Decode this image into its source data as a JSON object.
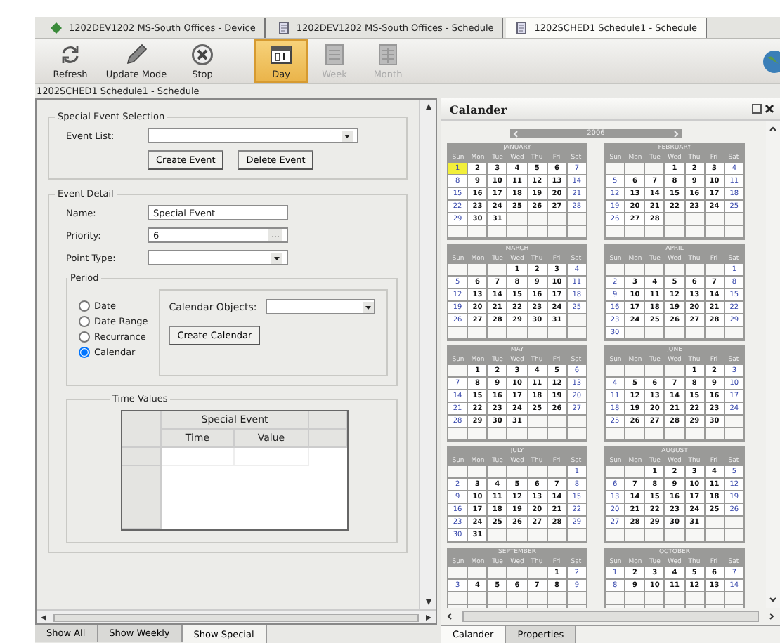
{
  "document_tabs": [
    {
      "label": "1202DEV1202 MS-South Offices - Device",
      "kind": "device",
      "selected": false
    },
    {
      "label": "1202DEV1202 MS-South Offices - Schedule",
      "kind": "schedule",
      "selected": false
    },
    {
      "label": "1202SCHED1 Schedule1 - Schedule",
      "kind": "schedule",
      "selected": true
    }
  ],
  "toolbar": [
    {
      "label": "Refresh",
      "kind": "refresh",
      "selected": false,
      "disabled": false
    },
    {
      "label": "Update Mode",
      "kind": "pencil",
      "selected": false,
      "disabled": false
    },
    {
      "label": "Stop",
      "kind": "stop",
      "selected": false,
      "disabled": false
    },
    {
      "label": "Day",
      "kind": "day",
      "selected": true,
      "disabled": false
    },
    {
      "label": "Week",
      "kind": "week",
      "selected": false,
      "disabled": true
    },
    {
      "label": "Month",
      "kind": "month",
      "selected": false,
      "disabled": true
    }
  ],
  "breadcrumb": "1202SCHED1 Schedule1 - Schedule",
  "special_event_selection": {
    "title": "Special Event Selection",
    "event_list_label": "Event List:",
    "buttons": [
      "Create Event",
      "Delete Event"
    ]
  },
  "event_detail": {
    "title": "Event Detail",
    "fields": [
      {
        "label": "Name:",
        "kind": "text",
        "value": "Special Event"
      },
      {
        "label": "Priority:",
        "kind": "ellipsis",
        "value": "6",
        "button": "..."
      },
      {
        "label": "Point Type:",
        "kind": "dropdown"
      }
    ]
  },
  "period": {
    "title": "Period",
    "options": [
      {
        "label": "Date",
        "selected": false
      },
      {
        "label": "Date Range",
        "selected": false
      },
      {
        "label": "Recurrance",
        "selected": false
      },
      {
        "label": "Calendar",
        "selected": true
      }
    ],
    "calendar_objects_label": "Calendar Objects:",
    "create_button": "Create Calendar"
  },
  "time_values": {
    "title": "Time Values",
    "group_header": "Special Event",
    "columns": [
      "Time",
      "Value"
    ]
  },
  "bottom_tabs": [
    {
      "label": "Show All",
      "selected": false
    },
    {
      "label": "Show Weekly",
      "selected": false
    },
    {
      "label": "Show Special",
      "selected": true
    }
  ],
  "calendar_panel": {
    "title": "Calander",
    "year": "2006",
    "months": [
      {
        "name": "JANUARY",
        "weekdays": [
          "Sun",
          "Mon",
          "Tue",
          "Wed",
          "Thu",
          "Fri",
          "Sat"
        ],
        "weeks": [
          [
            {
              "kind": "day",
              "text": "1",
              "selected": true
            },
            "2",
            "3",
            "4",
            "5",
            "6",
            "7"
          ],
          [
            "8",
            "9",
            "10",
            "11",
            "12",
            "13",
            "14"
          ],
          [
            "15",
            "16",
            "17",
            "18",
            "19",
            "20",
            "21"
          ],
          [
            "22",
            "23",
            "24",
            "25",
            "26",
            "27",
            "28"
          ],
          [
            "29",
            "30",
            "31",
            {
              "kind": "blank"
            },
            {
              "kind": "blank"
            },
            {
              "kind": "blank"
            },
            {
              "kind": "blank"
            }
          ]
        ]
      },
      {
        "name": "FEBRUARY",
        "weekdays": [
          "Sun",
          "Mon",
          "Tue",
          "Wed",
          "Thu",
          "Fri",
          "Sat"
        ],
        "weeks": [
          [
            {
              "kind": "blank"
            },
            {
              "kind": "blank"
            },
            {
              "kind": "blank"
            },
            "1",
            "2",
            "3",
            "4"
          ],
          [
            "5",
            "6",
            "7",
            "8",
            "9",
            "10",
            "11"
          ],
          [
            "12",
            "13",
            "14",
            "15",
            "16",
            "17",
            "18"
          ],
          [
            "19",
            "20",
            "21",
            "22",
            "23",
            "24",
            "25"
          ],
          [
            "26",
            "27",
            "28",
            {
              "kind": "blank"
            },
            {
              "kind": "blank"
            },
            {
              "kind": "blank"
            },
            {
              "kind": "blank"
            }
          ]
        ]
      },
      {
        "name": "MARCH",
        "weekdays": [
          "Sun",
          "Mon",
          "Tue",
          "Wed",
          "Thu",
          "Fri",
          "Sat"
        ],
        "weeks": [
          [
            {
              "kind": "blank"
            },
            {
              "kind": "blank"
            },
            {
              "kind": "blank"
            },
            "1",
            "2",
            "3",
            "4"
          ],
          [
            "5",
            "6",
            "7",
            "8",
            "9",
            "10",
            "11"
          ],
          [
            "12",
            "13",
            "14",
            "15",
            "16",
            "17",
            "18"
          ],
          [
            "19",
            "20",
            "21",
            "22",
            "23",
            "24",
            "25"
          ],
          [
            "26",
            "27",
            "28",
            "29",
            "30",
            "31",
            {
              "kind": "blank"
            }
          ]
        ]
      },
      {
        "name": "APRIL",
        "weekdays": [
          "Sun",
          "Mon",
          "Tue",
          "Wed",
          "Thu",
          "Fri",
          "Sat"
        ],
        "weeks": [
          [
            {
              "kind": "blank"
            },
            {
              "kind": "blank"
            },
            {
              "kind": "blank"
            },
            {
              "kind": "blank"
            },
            {
              "kind": "blank"
            },
            {
              "kind": "blank"
            },
            "1"
          ],
          [
            "2",
            "3",
            "4",
            "5",
            "6",
            "7",
            "8"
          ],
          [
            "9",
            "10",
            "11",
            "12",
            "13",
            "14",
            "15"
          ],
          [
            "16",
            "17",
            "18",
            "19",
            "20",
            "21",
            "22"
          ],
          [
            "23",
            "24",
            "25",
            "26",
            "27",
            "28",
            "29"
          ],
          [
            "30",
            {
              "kind": "blank"
            },
            {
              "kind": "blank"
            },
            {
              "kind": "blank"
            },
            {
              "kind": "blank"
            },
            {
              "kind": "blank"
            },
            {
              "kind": "blank"
            }
          ]
        ]
      },
      {
        "name": "MAY",
        "weekdays": [
          "Sun",
          "Mon",
          "Tue",
          "Wed",
          "Thu",
          "Fri",
          "Sat"
        ],
        "weeks": [
          [
            {
              "kind": "blank"
            },
            "1",
            "2",
            "3",
            "4",
            "5",
            "6"
          ],
          [
            "7",
            "8",
            "9",
            "10",
            "11",
            "12",
            "13"
          ],
          [
            "14",
            "15",
            "16",
            "17",
            "18",
            "19",
            "20"
          ],
          [
            "21",
            "22",
            "23",
            "24",
            "25",
            "26",
            "27"
          ],
          [
            "28",
            "29",
            "30",
            "31",
            {
              "kind": "blank"
            },
            {
              "kind": "blank"
            },
            {
              "kind": "blank"
            }
          ]
        ]
      },
      {
        "name": "JUNE",
        "weekdays": [
          "Sun",
          "Mon",
          "Tue",
          "Wed",
          "Thu",
          "Fri",
          "Sat"
        ],
        "weeks": [
          [
            {
              "kind": "blank"
            },
            {
              "kind": "blank"
            },
            {
              "kind": "blank"
            },
            {
              "kind": "blank"
            },
            "1",
            "2",
            "3"
          ],
          [
            "4",
            "5",
            "6",
            "7",
            "8",
            "9",
            "10"
          ],
          [
            "11",
            "12",
            "13",
            "14",
            "15",
            "16",
            "17"
          ],
          [
            "18",
            "19",
            "20",
            "21",
            "22",
            "23",
            "24"
          ],
          [
            "25",
            "26",
            "27",
            "28",
            "29",
            "30",
            {
              "kind": "blank"
            }
          ]
        ]
      },
      {
        "name": "JULY",
        "weekdays": [
          "Sun",
          "Mon",
          "Tue",
          "Wed",
          "Thu",
          "Fri",
          "Sat"
        ],
        "weeks": [
          [
            {
              "kind": "blank"
            },
            {
              "kind": "blank"
            },
            {
              "kind": "blank"
            },
            {
              "kind": "blank"
            },
            {
              "kind": "blank"
            },
            {
              "kind": "blank"
            },
            "1"
          ],
          [
            "2",
            "3",
            "4",
            "5",
            "6",
            "7",
            "8"
          ],
          [
            "9",
            "10",
            "11",
            "12",
            "13",
            "14",
            "15"
          ],
          [
            "16",
            "17",
            "18",
            "19",
            "20",
            "21",
            "22"
          ],
          [
            "23",
            "24",
            "25",
            "26",
            "27",
            "28",
            "29"
          ],
          [
            "30",
            "31",
            {
              "kind": "blank"
            },
            {
              "kind": "blank"
            },
            {
              "kind": "blank"
            },
            {
              "kind": "blank"
            },
            {
              "kind": "blank"
            }
          ]
        ]
      },
      {
        "name": "AUGUST",
        "weekdays": [
          "Sun",
          "Mon",
          "Tue",
          "Wed",
          "Thu",
          "Fri",
          "Sat"
        ],
        "weeks": [
          [
            {
              "kind": "blank"
            },
            {
              "kind": "blank"
            },
            "1",
            "2",
            "3",
            "4",
            "5"
          ],
          [
            "6",
            "7",
            "8",
            "9",
            "10",
            "11",
            "12"
          ],
          [
            "13",
            "14",
            "15",
            "16",
            "17",
            "18",
            "19"
          ],
          [
            "20",
            "21",
            "22",
            "23",
            "24",
            "25",
            "26"
          ],
          [
            "27",
            "28",
            "29",
            "30",
            "31",
            {
              "kind": "blank"
            },
            {
              "kind": "blank"
            }
          ]
        ]
      },
      {
        "name": "SEPTEMBER",
        "weekdays": [
          "Sun",
          "Mon",
          "Tue",
          "Wed",
          "Thu",
          "Fri",
          "Sat"
        ],
        "weeks": [
          [
            {
              "kind": "blank"
            },
            {
              "kind": "blank"
            },
            {
              "kind": "blank"
            },
            {
              "kind": "blank"
            },
            {
              "kind": "blank"
            },
            "1",
            "2"
          ],
          [
            "3",
            "4",
            "5",
            "6",
            "7",
            "8",
            "9"
          ]
        ]
      },
      {
        "name": "OCTOBER",
        "weekdays": [
          "Sun",
          "Mon",
          "Tue",
          "Wed",
          "Thu",
          "Fri",
          "Sat"
        ],
        "weeks": [
          [
            "1",
            "2",
            "3",
            "4",
            "5",
            "6",
            "7"
          ],
          [
            "8",
            "9",
            "10",
            "11",
            "12",
            "13",
            "14"
          ]
        ]
      }
    ]
  },
  "panel_tabs": [
    {
      "label": "Calander",
      "selected": true
    },
    {
      "label": "Properties",
      "selected": false
    }
  ]
}
